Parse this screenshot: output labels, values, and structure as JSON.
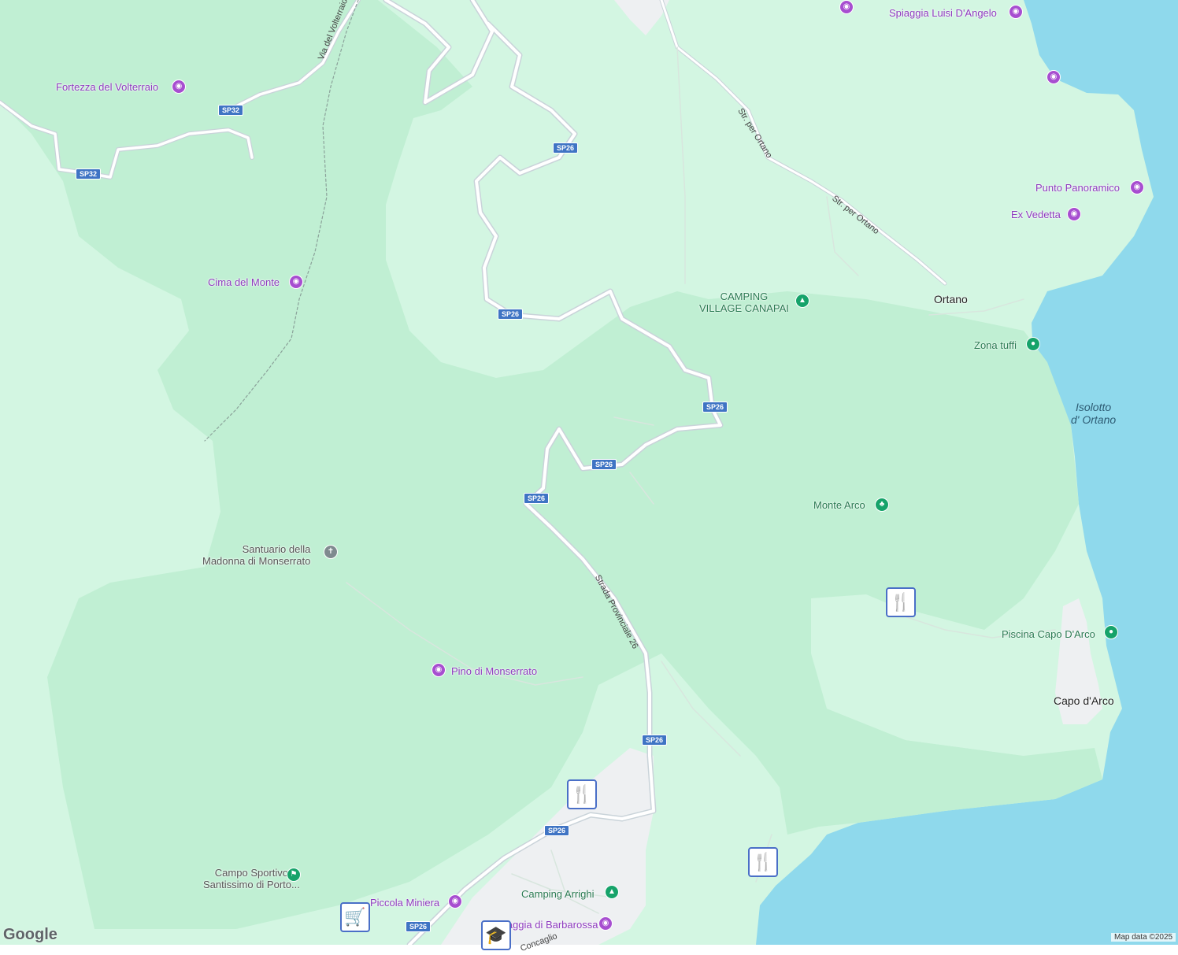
{
  "map": {
    "attribution": "Map data ©2025",
    "logo": "Google",
    "colors": {
      "sea": "#8fd9ec",
      "land_light": "#d3f6e2",
      "forest": "#c0efd3",
      "road": "#ffffff",
      "road_outline": "#c9d3d9",
      "poi_purple": "#a74ed0",
      "poi_green": "#16a36a"
    }
  },
  "places": {
    "ortano": "Ortano",
    "capo_darco": "Capo d'Arco",
    "isolotto_line1": "Isolotto",
    "isolotto_line2": "d' Ortano"
  },
  "pois": {
    "fortezza": "Fortezza del Volterraio",
    "cima": "Cima del Monte",
    "spiaggia_luisi": "Spiaggia Luisi D'Angelo",
    "punto_panoramico": "Punto Panoramico",
    "ex_vedetta": "Ex Vedetta",
    "camping_canapai_line1": "CAMPING",
    "camping_canapai_line2": "VILLAGE CANAPAI",
    "zona_tuffi": "Zona tuffi",
    "monte_arco": "Monte Arco",
    "santuario_line1": "Santuario della",
    "santuario_line2": "Madonna di Monserrato",
    "pino": "Pino di Monserrato",
    "piscina": "Piscina Capo D'Arco",
    "campo_line1": "Campo Sportivo",
    "campo_line2": "Santissimo di Porto...",
    "piccola_miniera": "Piccola Miniera",
    "camping_arrighi": "Camping Arrighi",
    "barbarossa": "Spiaggia di Barbarossa"
  },
  "streets": {
    "via_volterraio": "Via del Volterraio",
    "str_ortano_1": "Str. per Ortano",
    "str_ortano_2": "Str. per Ortano",
    "strada_provinciale": "Strada Provinciale 26",
    "concaglio": "Concaglio"
  },
  "shields": {
    "sp32_a": "SP32",
    "sp32_b": "SP32",
    "sp26_a": "SP26",
    "sp26_b": "SP26",
    "sp26_c": "SP26",
    "sp26_d": "SP26",
    "sp26_e": "SP26",
    "sp26_f": "SP26",
    "sp26_g": "SP26",
    "sp26_h": "SP26"
  },
  "icons": {
    "camera": "camera-icon",
    "tent": "tent-icon",
    "tree": "tree-icon",
    "cross": "cross-icon",
    "restaurant": "restaurant-icon",
    "shopping": "shopping-cart-icon",
    "school": "school-icon",
    "sports": "sports-icon"
  }
}
